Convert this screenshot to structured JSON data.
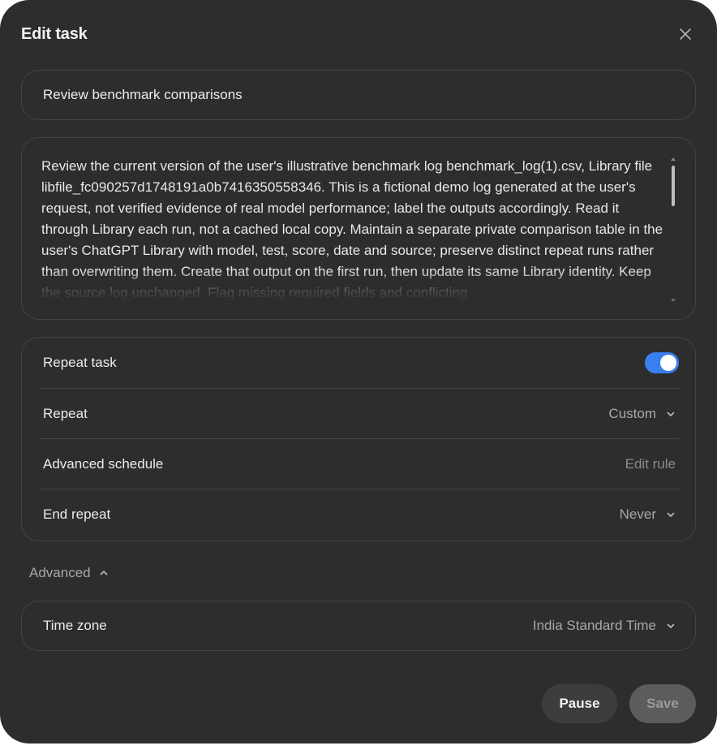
{
  "dialog": {
    "title": "Edit task",
    "close_icon": "close-icon"
  },
  "task": {
    "name": "Review benchmark comparisons",
    "prompt": "Review the current version of the user's illustrative benchmark log benchmark_log(1).csv, Library file libfile_fc090257d1748191a0b7416350558346. This is a fictional demo log generated at the user's request, not verified evidence of real model performance; label the outputs accordingly. Read it through Library each run, not a cached local copy. Maintain a separate private comparison table in the user's ChatGPT Library with model, test, score, date and source; preserve distinct repeat runs rather than overwriting them. Create that output on the first run, then update its same Library identity. Keep the source log unchanged. Flag missing required fields and conflicting"
  },
  "repeat": {
    "repeat_task_label": "Repeat task",
    "repeat_task_enabled": true,
    "repeat_label": "Repeat",
    "repeat_value": "Custom",
    "advanced_schedule_label": "Advanced schedule",
    "advanced_schedule_action": "Edit rule",
    "end_repeat_label": "End repeat",
    "end_repeat_value": "Never"
  },
  "advanced": {
    "label": "Advanced",
    "expanded": true,
    "time_zone_label": "Time zone",
    "time_zone_value": "India Standard Time"
  },
  "actions": {
    "pause_label": "Pause",
    "save_label": "Save"
  },
  "colors": {
    "dialog_bg": "#2d2d2d",
    "border": "#444444",
    "toggle_on": "#3a7ff0",
    "muted_text": "#a8a8a8"
  }
}
